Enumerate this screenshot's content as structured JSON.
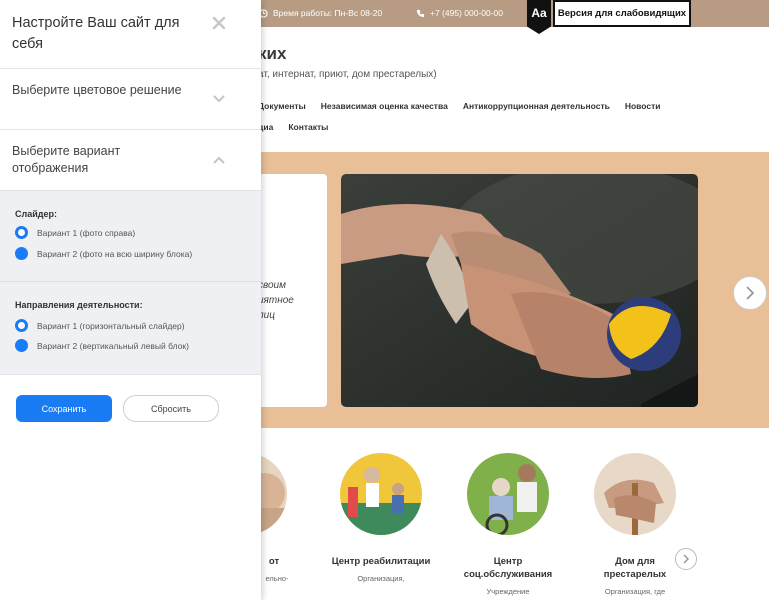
{
  "topbar": {
    "hours": "Время работы: Пн-Вс 08-20",
    "phone": "+7 (495) 000-00-00",
    "aa_label": "Aa",
    "vision_label": "Версия для слабовидящих",
    "bg_color": "#b79c83"
  },
  "brand": {
    "title_fragment": "ких",
    "subtitle_fragment": "ат, интернат, приют, дом престарелых)"
  },
  "nav": {
    "row1": [
      "Документы",
      "Независимая оценка качества",
      "Антикоррупционная деятельность",
      "Новости"
    ],
    "row2": [
      "диа",
      "Контакты"
    ]
  },
  "hero": {
    "text_fragment": "своим\nиятное\nлиц",
    "next_icon": "chevron-right-icon",
    "bg_color": "#e9bf97"
  },
  "services": [
    {
      "title": "от",
      "desc": "ельно-"
    },
    {
      "title": "Центр реабилитации",
      "desc": "Организация,"
    },
    {
      "title": "Центр соц.обслуживания",
      "desc": "Учреждение"
    },
    {
      "title": "Дом для престарелых",
      "desc": "Организация, где"
    }
  ],
  "panel": {
    "title": "Настройте Ваш сайт для себя",
    "close_icon": "close-icon",
    "sections": [
      {
        "label": "Выберите цветовое решение",
        "icon": "chevron-down-icon"
      },
      {
        "label": "Выберите вариант отображения",
        "icon": "chevron-up-icon"
      }
    ],
    "slider_group": {
      "title": "Слайдер:",
      "options": [
        "Вариант 1 (фото справа)",
        "Вариант 2 (фото на всю ширину блока)"
      ],
      "selected": 0
    },
    "direction_group": {
      "title": "Направления деятельности:",
      "options": [
        "Вариант 1 (горизонтальный слайдер)",
        "Вариант 2 (вертикальный левый блок)"
      ],
      "selected": 0
    },
    "save_label": "Сохранить",
    "reset_label": "Сбросить",
    "accent_color": "#1a7cf5"
  }
}
